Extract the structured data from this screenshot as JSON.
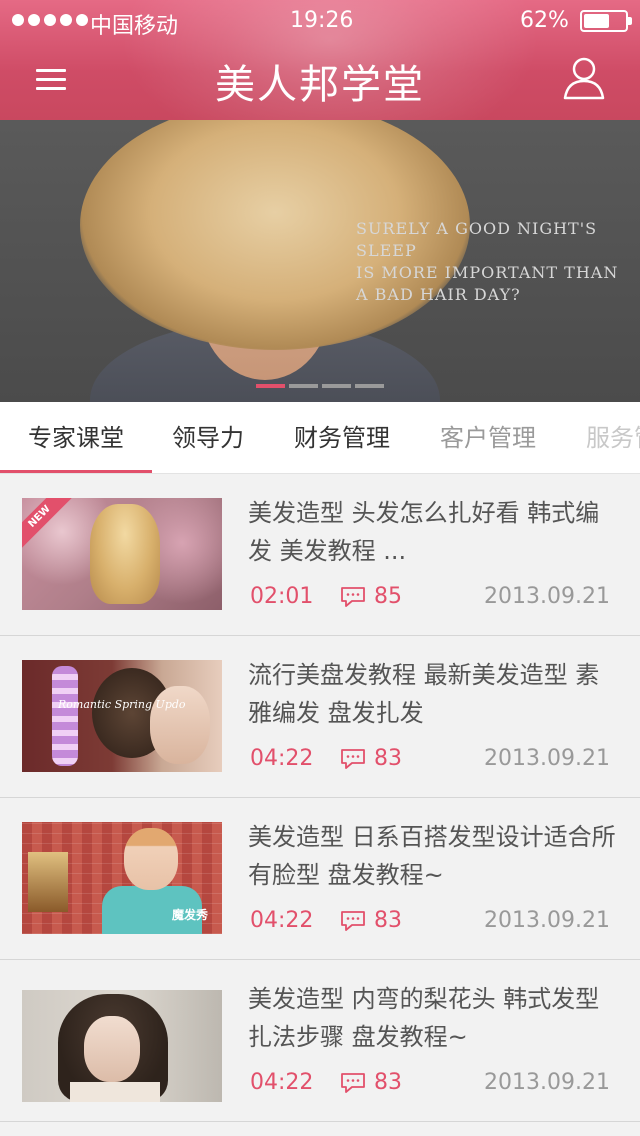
{
  "status_bar": {
    "carrier": "中国移动",
    "time": "19:26",
    "battery": "62%",
    "battery_level": 0.62
  },
  "header": {
    "title": "美人邦学堂",
    "menu_icon": "hamburger-menu-icon",
    "user_icon": "user-profile-icon"
  },
  "banner": {
    "tagline": [
      "SURELY A GOOD NIGHT'S SLEEP",
      "IS MORE IMPORTANT THAN",
      "A BAD HAIR DAY?"
    ],
    "active_slide": 1,
    "slide_count": 4
  },
  "tabs": [
    {
      "label": "专家课堂",
      "active": true
    },
    {
      "label": "领导力",
      "active": false
    },
    {
      "label": "财务管理",
      "active": false
    },
    {
      "label": "客户管理",
      "active": false
    },
    {
      "label": "服务管",
      "active": false
    }
  ],
  "videos": [
    {
      "title": "美发造型 头发怎么扎好看 韩式编发 美发教程 ...",
      "duration": "02:01",
      "comments": "85",
      "date": "2013.09.21",
      "badge": "NEW"
    },
    {
      "title": "流行美盘发教程 最新美发造型 素雅编发 盘发扎发",
      "duration": "04:22",
      "comments": "83",
      "date": "2013.09.21",
      "thumb_text": "Romantic Spring Updo"
    },
    {
      "title": "美发造型 日系百搭发型设计适合所有脸型 盘发教程~",
      "duration": "04:22",
      "comments": "83",
      "date": "2013.09.21",
      "thumb_text": "魔发秀"
    },
    {
      "title": "美发造型 内弯的梨花头 韩式发型扎法步骤 盘发教程~",
      "duration": "04:22",
      "comments": "83",
      "date": "2013.09.21"
    }
  ],
  "colors": {
    "accent": "#e2506b",
    "header": "#d4506a",
    "muted": "#999999"
  }
}
